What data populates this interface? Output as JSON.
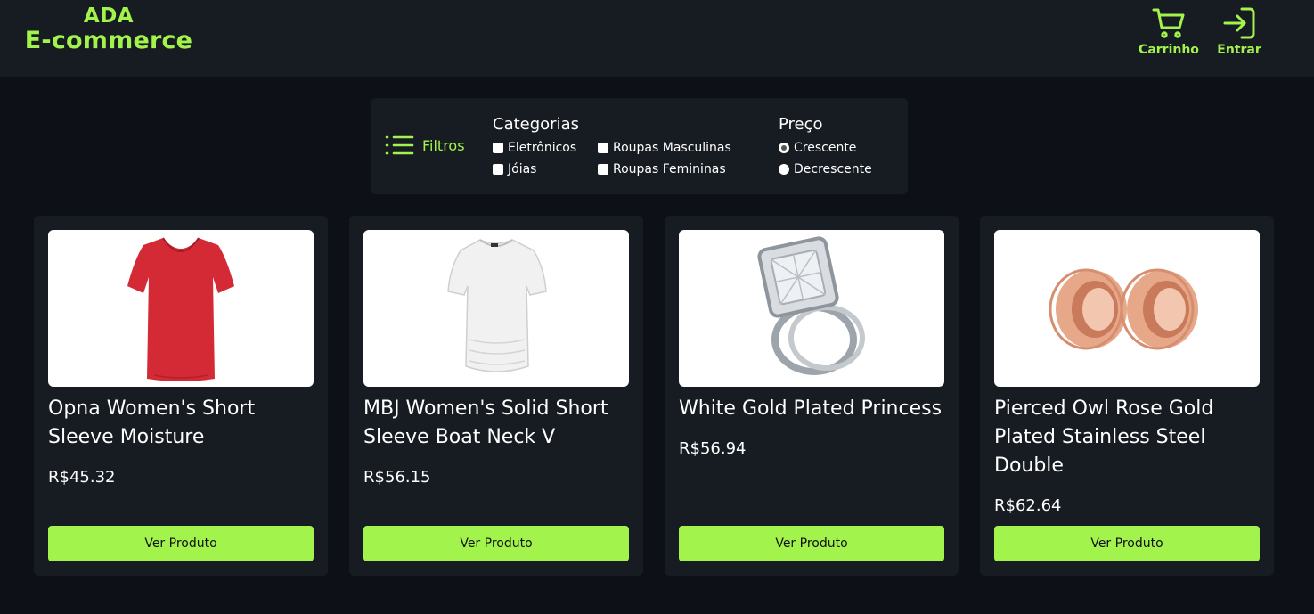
{
  "header": {
    "logo_line1": "ADA",
    "logo_line2": "E-commerce",
    "cart_label": "Carrinho",
    "login_label": "Entrar",
    "accent_color": "#a3f34d"
  },
  "filters": {
    "toggle_label": "Filtros",
    "categories_title": "Categorias",
    "categories": [
      {
        "label": "Eletrônicos",
        "checked": false
      },
      {
        "label": "Jóias",
        "checked": false
      },
      {
        "label": "Roupas Masculinas",
        "checked": false
      },
      {
        "label": "Roupas Femininas",
        "checked": false
      }
    ],
    "price_title": "Preço",
    "price_options": [
      {
        "label": "Crescente",
        "selected": true
      },
      {
        "label": "Decrescente",
        "selected": false
      }
    ]
  },
  "products": [
    {
      "title": "Opna Women's Short Sleeve Moisture",
      "price": "R$45.32",
      "button": "Ver Produto",
      "image_icon": "red-tshirt-image"
    },
    {
      "title": "MBJ Women's Solid Short Sleeve Boat Neck V",
      "price": "R$56.15",
      "button": "Ver Produto",
      "image_icon": "white-top-image"
    },
    {
      "title": "White Gold Plated Princess",
      "price": "R$56.94",
      "button": "Ver Produto",
      "image_icon": "diamond-ring-image"
    },
    {
      "title": "Pierced Owl Rose Gold Plated Stainless Steel Double",
      "price": "R$62.64",
      "button": "Ver Produto",
      "image_icon": "rose-gold-plugs-image"
    }
  ]
}
